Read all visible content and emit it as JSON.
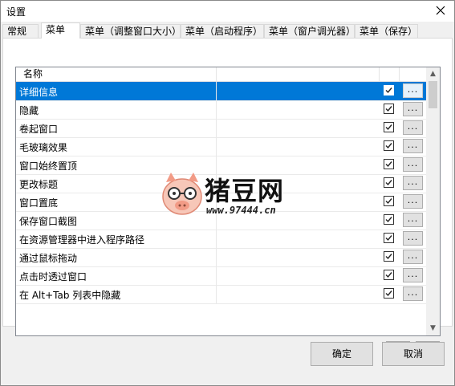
{
  "window": {
    "title": "设置"
  },
  "tabs": [
    {
      "label": "常规",
      "active": false
    },
    {
      "label": "菜单",
      "active": true
    },
    {
      "label": "菜单（调整窗口大小）",
      "active": false
    },
    {
      "label": "菜单（启动程序）",
      "active": false
    },
    {
      "label": "菜单（窗户调光器）",
      "active": false
    },
    {
      "label": "菜单（保存）",
      "active": false
    }
  ],
  "list": {
    "column_header": "名称",
    "items": [
      {
        "label": "详细信息",
        "checked": true,
        "selected": true
      },
      {
        "label": "隐藏",
        "checked": true
      },
      {
        "label": "卷起窗口",
        "checked": true
      },
      {
        "label": "毛玻璃效果",
        "checked": true
      },
      {
        "label": "窗口始终置顶",
        "checked": true
      },
      {
        "label": "更改标题",
        "checked": true
      },
      {
        "label": "窗口置底",
        "checked": true
      },
      {
        "label": "保存窗口截图",
        "checked": true
      },
      {
        "label": "在资源管理器中进入程序路径",
        "checked": true
      },
      {
        "label": "通过鼠标拖动",
        "checked": true
      },
      {
        "label": "点击时透过窗口",
        "checked": true
      },
      {
        "label": "在 Alt+Tab 列表中隐藏",
        "checked": true
      }
    ],
    "dots_label": "..."
  },
  "buttons": {
    "ok": "确定",
    "cancel": "取消"
  },
  "watermark": {
    "brand": "猪豆网",
    "url": "www.97444.cn"
  },
  "colors": {
    "selection": "#0078d7",
    "window_bg": "#f0f0f0"
  }
}
